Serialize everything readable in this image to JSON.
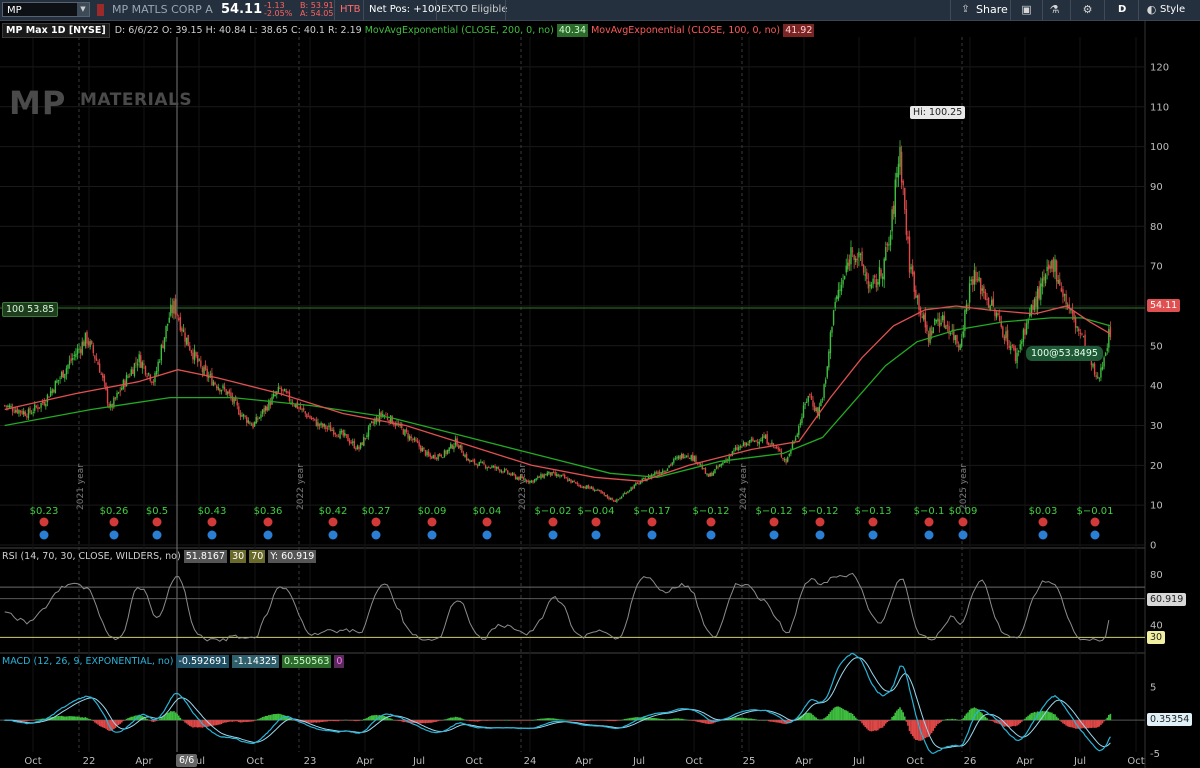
{
  "toolbar": {
    "symbol": "MP",
    "company": "MP MATLS CORP A",
    "last": "54.11",
    "change": "-1.13",
    "change_pct": "-2.05%",
    "bid": "B: 53.91",
    "ask": "A: 54.05",
    "htb": "HTB",
    "net_pos": "Net Pos: +100",
    "exto": "EXTO Eligible",
    "share": "Share",
    "timeframe": "D",
    "style": "Style"
  },
  "price_panel": {
    "title": "MP Max 1D [NYSE]",
    "date": "D: 6/6/22",
    "open": "O: 39.15",
    "high": "H: 40.84",
    "low": "L: 38.65",
    "close": "C: 40.1",
    "range": "R: 2.19",
    "ema200_label": "MovAvgExponential (CLOSE, 200, 0, no)",
    "ema200_value": "40.34",
    "ema100_label": "MovAvgExponential (CLOSE, 100, 0, no)",
    "ema100_value": "41.92",
    "logo_mp": "MP",
    "logo_materials": "MATERIALS",
    "position_label": "100 53.85",
    "last_tag": "54.11",
    "hi_label": "Hi: 100.25",
    "fill_label": "100@53.8495"
  },
  "rsi_panel": {
    "title": "RSI (14, 70, 30, CLOSE, WILDERS, no)",
    "value": "51.8167",
    "os": "30",
    "ob": "70",
    "y": "Y: 60.919",
    "last_tag": "60.919",
    "os_tag": "30"
  },
  "macd_panel": {
    "title": "MACD (12, 26, 9, EXPONENTIAL, no)",
    "value": "-0.592691",
    "avg": "-1.14325",
    "diff": "0.550563",
    "zero": "0",
    "last_tag": "0.35354"
  },
  "cursor_date": "6/6",
  "colors": {
    "up": "#3fbf3f",
    "down": "#e04848",
    "ema100": "#e05050",
    "ema200": "#22aa22",
    "rsi": "#8c8c8c",
    "macd": "#28b4d8",
    "signal": "#9ad8ee"
  },
  "chart_data": [
    {
      "type": "candlestick",
      "title": "MP Max 1D [NYSE]",
      "ylim": [
        0,
        125
      ],
      "y_ticks": [
        0,
        10,
        20,
        30,
        40,
        50,
        60,
        70,
        80,
        90,
        100,
        110,
        120
      ],
      "x_ticks": [
        "Oct",
        "22",
        "Apr",
        "Jul",
        "Oct",
        "23",
        "Apr",
        "Jul",
        "Oct",
        "24",
        "Apr",
        "Jul",
        "Oct",
        "25",
        "Apr",
        "Jul",
        "Oct",
        "26",
        "Apr",
        "Jul",
        "Oct"
      ],
      "year_markers": [
        "2021 year",
        "2022 year",
        "2023 year",
        "2024 year",
        "2025 year"
      ],
      "series": [
        {
          "name": "price",
          "points": [
            [
              2020.75,
              35
            ],
            [
              2020.9,
              33
            ],
            [
              2021.0,
              36
            ],
            [
              2021.1,
              42
            ],
            [
              2021.2,
              48
            ],
            [
              2021.27,
              52
            ],
            [
              2021.35,
              45
            ],
            [
              2021.42,
              34
            ],
            [
              2021.5,
              40
            ],
            [
              2021.6,
              47
            ],
            [
              2021.7,
              41
            ],
            [
              2021.75,
              50
            ],
            [
              2021.8,
              58
            ],
            [
              2021.83,
              60
            ],
            [
              2021.9,
              52
            ],
            [
              2022.0,
              44
            ],
            [
              2022.08,
              41
            ],
            [
              2022.17,
              38
            ],
            [
              2022.25,
              33
            ],
            [
              2022.33,
              30
            ],
            [
              2022.42,
              35
            ],
            [
              2022.5,
              39
            ],
            [
              2022.58,
              36
            ],
            [
              2022.66,
              33
            ],
            [
              2022.75,
              30
            ],
            [
              2022.83,
              29
            ],
            [
              2022.92,
              27
            ],
            [
              2023.0,
              24
            ],
            [
              2023.08,
              30
            ],
            [
              2023.15,
              33
            ],
            [
              2023.22,
              31
            ],
            [
              2023.3,
              28
            ],
            [
              2023.38,
              25
            ],
            [
              2023.45,
              22
            ],
            [
              2023.55,
              23
            ],
            [
              2023.62,
              26
            ],
            [
              2023.7,
              21
            ],
            [
              2023.8,
              20
            ],
            [
              2023.9,
              19
            ],
            [
              2024.0,
              17
            ],
            [
              2024.1,
              16
            ],
            [
              2024.2,
              18
            ],
            [
              2024.3,
              17
            ],
            [
              2024.4,
              15
            ],
            [
              2024.5,
              14
            ],
            [
              2024.58,
              12
            ],
            [
              2024.64,
              11
            ],
            [
              2024.72,
              14
            ],
            [
              2024.8,
              16
            ],
            [
              2024.88,
              18
            ],
            [
              2024.95,
              19
            ],
            [
              2025.0,
              21
            ],
            [
              2025.08,
              23
            ],
            [
              2025.16,
              21
            ],
            [
              2025.22,
              17
            ],
            [
              2025.3,
              20
            ],
            [
              2025.4,
              24
            ],
            [
              2025.5,
              26
            ],
            [
              2025.58,
              27
            ],
            [
              2025.66,
              24
            ],
            [
              2025.72,
              21
            ],
            [
              2025.8,
              30
            ],
            [
              2025.86,
              38
            ],
            [
              2025.92,
              33
            ],
            [
              2025.97,
              41
            ],
            [
              2026.02,
              60
            ],
            [
              2026.08,
              66
            ],
            [
              2026.14,
              75
            ],
            [
              2026.2,
              70
            ],
            [
              2026.26,
              64
            ],
            [
              2026.32,
              68
            ],
            [
              2026.38,
              77
            ],
            [
              2026.44,
              100
            ],
            [
              2026.5,
              71
            ],
            [
              2026.56,
              61
            ],
            [
              2026.62,
              52
            ],
            [
              2026.68,
              57
            ],
            [
              2026.75,
              55
            ],
            [
              2026.82,
              50
            ],
            [
              2026.9,
              68
            ],
            [
              2026.97,
              64
            ],
            [
              2027.05,
              58
            ],
            [
              2027.12,
              52
            ],
            [
              2027.18,
              47
            ],
            [
              2027.24,
              55
            ],
            [
              2027.3,
              61
            ],
            [
              2027.36,
              66
            ],
            [
              2027.42,
              71
            ],
            [
              2027.48,
              63
            ],
            [
              2027.54,
              57
            ],
            [
              2027.6,
              52
            ],
            [
              2027.66,
              45
            ],
            [
              2027.7,
              41
            ],
            [
              2027.74,
              48
            ],
            [
              2027.78,
              54
            ]
          ]
        },
        {
          "name": "EMA 100",
          "points": [
            [
              2020.75,
              34
            ],
            [
              2021.2,
              38
            ],
            [
              2021.6,
              41
            ],
            [
              2021.85,
              44
            ],
            [
              2022.1,
              42
            ],
            [
              2022.5,
              38
            ],
            [
              2022.9,
              33
            ],
            [
              2023.3,
              30
            ],
            [
              2023.7,
              25
            ],
            [
              2024.1,
              20
            ],
            [
              2024.5,
              17
            ],
            [
              2024.8,
              16
            ],
            [
              2025.1,
              20
            ],
            [
              2025.5,
              24
            ],
            [
              2025.8,
              26
            ],
            [
              2026.0,
              37
            ],
            [
              2026.2,
              47
            ],
            [
              2026.4,
              55
            ],
            [
              2026.6,
              59
            ],
            [
              2026.8,
              60
            ],
            [
              2027.0,
              59
            ],
            [
              2027.3,
              58
            ],
            [
              2027.5,
              60
            ],
            [
              2027.65,
              56
            ],
            [
              2027.78,
              53
            ]
          ]
        },
        {
          "name": "EMA 200",
          "points": [
            [
              2020.75,
              30
            ],
            [
              2021.3,
              34
            ],
            [
              2021.8,
              37
            ],
            [
              2022.2,
              37
            ],
            [
              2022.7,
              35
            ],
            [
              2023.2,
              32
            ],
            [
              2023.7,
              27
            ],
            [
              2024.2,
              22
            ],
            [
              2024.6,
              18
            ],
            [
              2024.9,
              17
            ],
            [
              2025.3,
              21
            ],
            [
              2025.7,
              23
            ],
            [
              2025.95,
              27
            ],
            [
              2026.15,
              36
            ],
            [
              2026.35,
              45
            ],
            [
              2026.55,
              51
            ],
            [
              2026.8,
              54
            ],
            [
              2027.1,
              56
            ],
            [
              2027.4,
              57
            ],
            [
              2027.6,
              57
            ],
            [
              2027.78,
              55
            ]
          ]
        }
      ],
      "dividends": [
        {
          "x": 2021.05,
          "label": "$0.23"
        },
        {
          "x": 2021.32,
          "label": "$0.26"
        },
        {
          "x": 2021.56,
          "label": "$0.5"
        },
        {
          "x": 2021.85,
          "label": "$0.43"
        },
        {
          "x": 2022.13,
          "label": "$0.36"
        },
        {
          "x": 2022.42,
          "label": "$0.42"
        },
        {
          "x": 2022.66,
          "label": "$0.27"
        },
        {
          "x": 2022.9,
          "label": "$0.09"
        },
        {
          "x": 2023.17,
          "label": "$0.04"
        },
        {
          "x": 2023.42,
          "label": "$−0.02"
        },
        {
          "x": 2023.66,
          "label": "$−0.04"
        },
        {
          "x": 2023.92,
          "label": "$−0.17"
        },
        {
          "x": 2024.17,
          "label": "$−0.12"
        },
        {
          "x": 2024.42,
          "label": "$−0.12"
        },
        {
          "x": 2024.66,
          "label": "$−0.12"
        },
        {
          "x": 2024.92,
          "label": "$−0.13"
        },
        {
          "x": 2025.17,
          "label": "$−0.1"
        },
        {
          "x": 2025.42,
          "label": "$0.09"
        },
        {
          "x": 2025.66,
          "label": "$0.03"
        },
        {
          "x": 2025.92,
          "label": "$−0.01"
        }
      ]
    },
    {
      "type": "line",
      "title": "RSI (14, 70, 30, CLOSE, WILDERS, no)",
      "ylim": [
        20,
        90
      ],
      "y_ticks": [
        40,
        60,
        80
      ],
      "levels": [
        30,
        70
      ],
      "series": [
        {
          "name": "RSI",
          "last": 60.919
        }
      ]
    },
    {
      "type": "bar",
      "title": "MACD (12, 26, 9, EXPONENTIAL, no)",
      "ylim": [
        -6,
        8
      ],
      "y_ticks": [
        -5,
        0,
        5
      ],
      "series": [
        {
          "name": "MACD",
          "last": 0.35354
        }
      ]
    }
  ]
}
